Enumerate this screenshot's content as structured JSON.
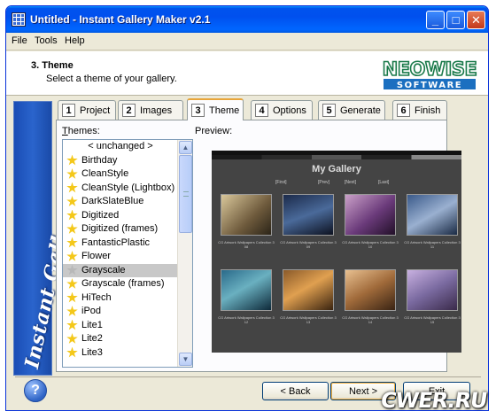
{
  "window": {
    "title": "Untitled - Instant Gallery Maker v2.1"
  },
  "menu": {
    "items": [
      "File",
      "Tools",
      "Help"
    ]
  },
  "header": {
    "step_title": "3. Theme",
    "step_subtitle": "Select a theme of your gallery."
  },
  "logo": {
    "line1": "NEOWISE",
    "line2": "SOFTWARE"
  },
  "sidebar": {
    "text": "Instant Gallery Maker"
  },
  "tabs": [
    {
      "num": "1",
      "label": "Project"
    },
    {
      "num": "2",
      "label": "Images"
    },
    {
      "num": "3",
      "label": "Theme"
    },
    {
      "num": "4",
      "label": "Options"
    },
    {
      "num": "5",
      "label": "Generate"
    },
    {
      "num": "6",
      "label": "Finish"
    }
  ],
  "active_tab": "Theme",
  "themes": {
    "label_first": "T",
    "label_rest": "hemes:",
    "items": [
      "< unchanged >",
      "Birthday",
      "CleanStyle",
      "CleanStyle (Lightbox)",
      "DarkSlateBlue",
      "Digitized",
      "Digitized (frames)",
      "FantasticPlastic",
      "Flower",
      "Grayscale",
      "Grayscale (frames)",
      "HiTech",
      "iPod",
      "Lite1",
      "Lite2",
      "Lite3"
    ],
    "selected": "Grayscale"
  },
  "preview": {
    "label": "Preview:",
    "gallery_title": "My Gallery",
    "nav": [
      "[First]",
      "[Prev]",
      "[Next]",
      "[Last]"
    ],
    "captions": [
      "CG Artwork Wallpapers Collection 3 08",
      "CG Artwork Wallpapers Collection 3 09",
      "CG Artwork Wallpapers Collection 3 10",
      "CG Artwork Wallpapers Collection 3 11",
      "CG Artwork Wallpapers Collection 3 12",
      "CG Artwork Wallpapers Collection 3 13",
      "CG Artwork Wallpapers Collection 3 14",
      "CG Artwork Wallpapers Collection 3 15"
    ]
  },
  "buttons": {
    "help": "?",
    "back": "< Back",
    "next": "Next >",
    "exit": "Exit"
  },
  "watermark": "CWER.RU",
  "colors": {
    "titlebar": "#0053ee",
    "sidebar": "#2a64cc",
    "selection": "#c8c8c8",
    "accent_tab": "#e8a53a"
  }
}
